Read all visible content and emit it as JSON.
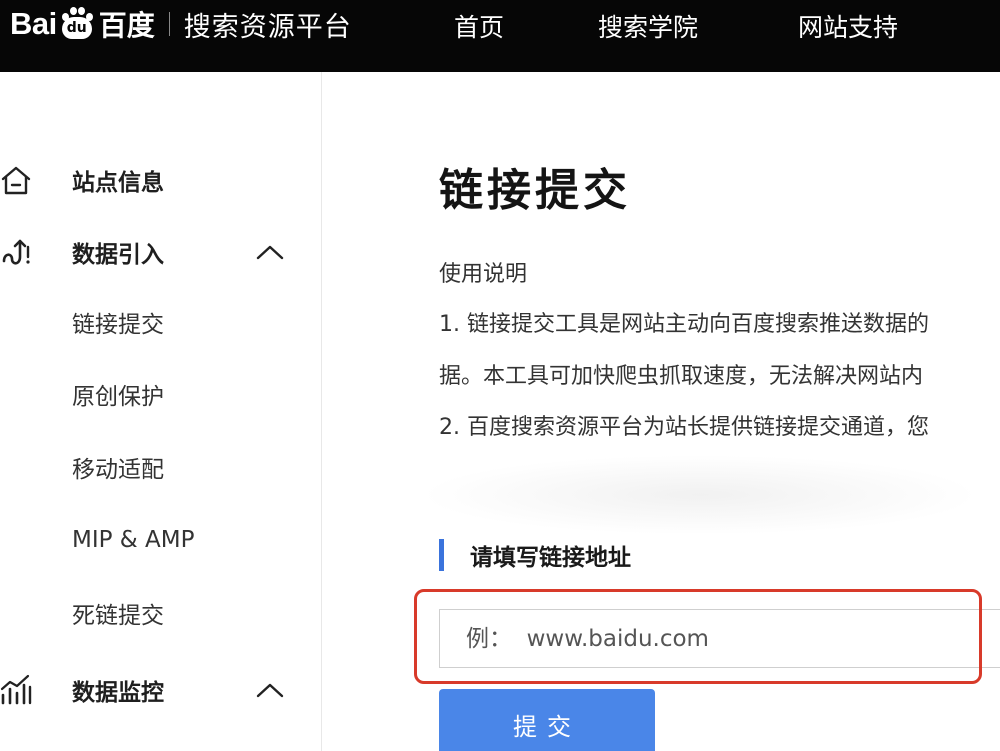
{
  "header": {
    "logo_bai": "Bai",
    "logo_du": "du",
    "logo_cn": "百度",
    "platform_name": "搜索资源平台",
    "nav": [
      "首页",
      "搜索学院",
      "网站支持"
    ]
  },
  "sidebar": {
    "items": [
      {
        "label": "站点信息",
        "icon": "home-icon",
        "kind": "group"
      },
      {
        "label": "数据引入",
        "icon": "data-import-icon",
        "kind": "group",
        "expanded": true
      },
      {
        "label": "链接提交",
        "kind": "sub"
      },
      {
        "label": "原创保护",
        "kind": "sub"
      },
      {
        "label": "移动适配",
        "kind": "sub"
      },
      {
        "label": "MIP & AMP",
        "kind": "sub"
      },
      {
        "label": "死链提交",
        "kind": "sub"
      },
      {
        "label": "数据监控",
        "icon": "chart-icon",
        "kind": "group",
        "expanded": true
      }
    ]
  },
  "main": {
    "title": "链接提交",
    "usage_heading": "使用说明",
    "lines": [
      "1. 链接提交工具是网站主动向百度搜索推送数据的",
      "据。本工具可加快爬虫抓取速度，无法解决网站内",
      "2. 百度搜索资源平台为站长提供链接提交通道，您"
    ],
    "section_title": "请填写链接地址",
    "input_placeholder": "例：  www.baidu.com",
    "submit_label": "提交"
  },
  "colors": {
    "topbar": "#060606",
    "accent": "#3a73dc",
    "button": "#4a86e8",
    "highlight": "#d83a2a"
  }
}
